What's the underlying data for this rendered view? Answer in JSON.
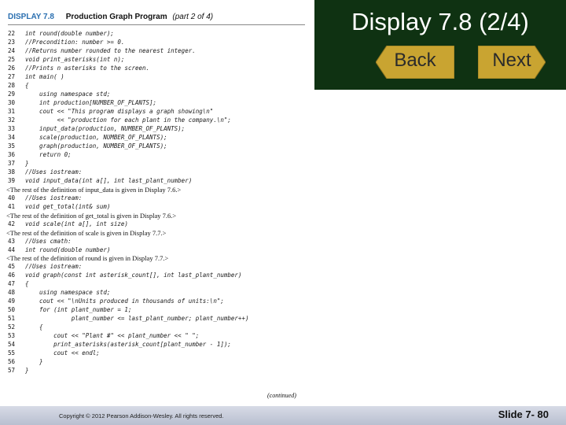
{
  "header": {
    "display_label": "DISPLAY 7.8",
    "program_title": "Production Graph Program",
    "part": "(part 2 of 4)"
  },
  "code_lines": [
    {
      "num": "22",
      "text": "int round(double number);",
      "kind": "code"
    },
    {
      "num": "23",
      "text": "//Precondition: number >= 0.",
      "kind": "code"
    },
    {
      "num": "24",
      "text": "//Returns number rounded to the nearest integer.",
      "kind": "code"
    },
    {
      "num": "25",
      "text": "void print_asterisks(int n);",
      "kind": "code"
    },
    {
      "num": "26",
      "text": "//Prints n asterisks to the screen.",
      "kind": "code"
    },
    {
      "num": "27",
      "text": "int main( )",
      "kind": "code"
    },
    {
      "num": "28",
      "text": "{",
      "kind": "code"
    },
    {
      "num": "29",
      "text": "    using namespace std;",
      "kind": "code"
    },
    {
      "num": "30",
      "text": "    int production[NUMBER_OF_PLANTS];",
      "kind": "code"
    },
    {
      "num": "31",
      "text": "    cout << \"This program displays a graph showing\\n\"",
      "kind": "code"
    },
    {
      "num": "32",
      "text": "         << \"production for each plant in the company.\\n\";",
      "kind": "code"
    },
    {
      "num": "33",
      "text": "    input_data(production, NUMBER_OF_PLANTS);",
      "kind": "code"
    },
    {
      "num": "34",
      "text": "    scale(production, NUMBER_OF_PLANTS);",
      "kind": "code"
    },
    {
      "num": "35",
      "text": "    graph(production, NUMBER_OF_PLANTS);",
      "kind": "code"
    },
    {
      "num": "36",
      "text": "    return 0;",
      "kind": "code"
    },
    {
      "num": "37",
      "text": "}",
      "kind": "code"
    },
    {
      "num": "38",
      "text": "//Uses iostream:",
      "kind": "code"
    },
    {
      "num": "39",
      "text": "void input_data(int a[], int last_plant_number)",
      "kind": "code"
    },
    {
      "num": "",
      "text": "<The rest of the definition of input_data is given in Display 7.6.>",
      "kind": "note"
    },
    {
      "num": "40",
      "text": "//Uses iostream:",
      "kind": "code"
    },
    {
      "num": "41",
      "text": "void get_total(int& sum)",
      "kind": "code"
    },
    {
      "num": "",
      "text": "<The rest of the definition of get_total is given in Display 7.6.>",
      "kind": "note"
    },
    {
      "num": "42",
      "text": "void scale(int a[], int size)",
      "kind": "code"
    },
    {
      "num": "",
      "text": "<The rest of the definition of scale is given in Display 7.7.>",
      "kind": "note"
    },
    {
      "num": "43",
      "text": "//Uses cmath:",
      "kind": "code"
    },
    {
      "num": "44",
      "text": "int round(double number)",
      "kind": "code"
    },
    {
      "num": "",
      "text": "<The rest of the definition of round is given in Display 7.7.>",
      "kind": "note"
    },
    {
      "num": "45",
      "text": "//Uses iostream:",
      "kind": "code"
    },
    {
      "num": "46",
      "text": "void graph(const int asterisk_count[], int last_plant_number)",
      "kind": "code"
    },
    {
      "num": "47",
      "text": "{",
      "kind": "code"
    },
    {
      "num": "48",
      "text": "    using namespace std;",
      "kind": "code"
    },
    {
      "num": "49",
      "text": "    cout << \"\\nUnits produced in thousands of units:\\n\";",
      "kind": "code"
    },
    {
      "num": "50",
      "text": "    for (int plant_number = 1;",
      "kind": "code"
    },
    {
      "num": "51",
      "text": "             plant_number <= last_plant_number; plant_number++)",
      "kind": "code"
    },
    {
      "num": "52",
      "text": "    {",
      "kind": "code"
    },
    {
      "num": "53",
      "text": "        cout << \"Plant #\" << plant_number << \" \";",
      "kind": "code"
    },
    {
      "num": "54",
      "text": "        print_asterisks(asterisk_count[plant_number - 1]);",
      "kind": "code"
    },
    {
      "num": "55",
      "text": "        cout << endl;",
      "kind": "code"
    },
    {
      "num": "56",
      "text": "    }",
      "kind": "code"
    },
    {
      "num": "57",
      "text": "}",
      "kind": "code"
    }
  ],
  "continued_label": "(continued)",
  "slide": {
    "title": "Display 7.8 (2/4)",
    "back_label": "Back",
    "next_label": "Next",
    "copyright": "Copyright © 2012 Pearson Addison-Wesley. All rights reserved.",
    "slide_number": "Slide 7- 80"
  },
  "colors": {
    "title_bg": "#0f3212",
    "nav_button": "#c9a431",
    "display_label": "#2a6fb0",
    "footer_bg": "#c4c9d8"
  }
}
